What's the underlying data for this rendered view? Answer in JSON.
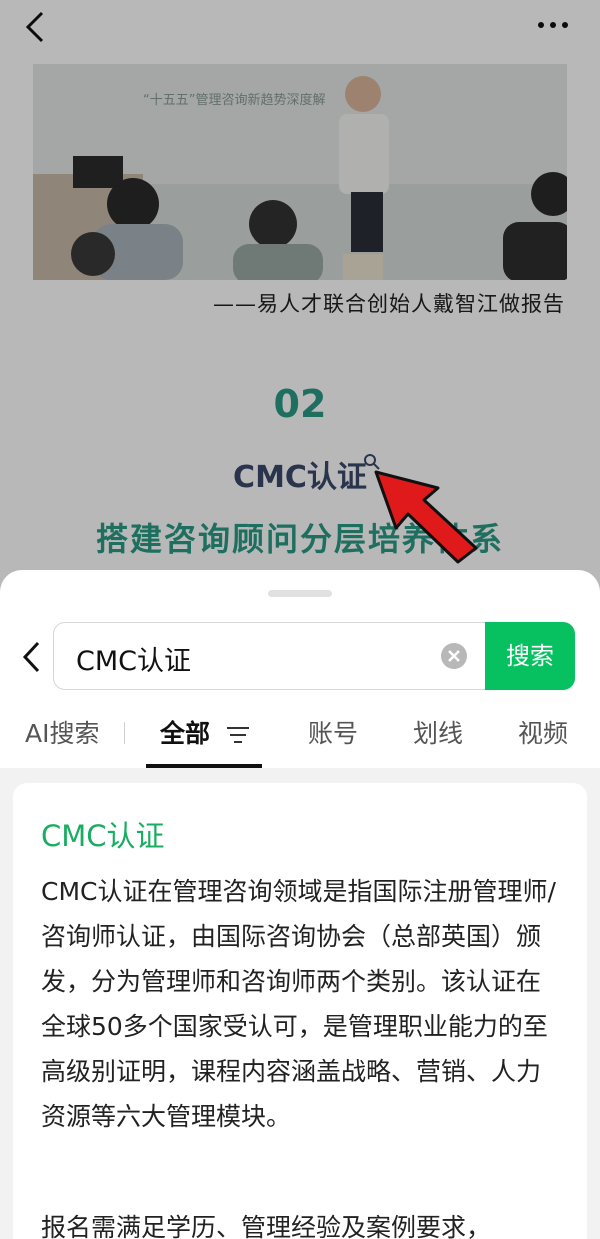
{
  "article": {
    "photo_caption": "——易人才联合创始人戴智江做报告",
    "photo_slide_text": "“十五五”管理咨询新趋势深度解",
    "section_number": "02",
    "section_title": "CMC认证",
    "section_subtitle": "搭建咨询顾问分层培养体系"
  },
  "search": {
    "query": "CMC认证",
    "button_label": "搜索"
  },
  "tabs": [
    {
      "label": "AI搜索"
    },
    {
      "label": "全部"
    },
    {
      "label": "账号"
    },
    {
      "label": "划线"
    },
    {
      "label": "视频"
    }
  ],
  "result": {
    "title": "CMC认证",
    "paragraph1": "CMC认证在管理咨询领域是指国际注册管理师/咨询师认证，由国际咨询协会（总部英国）颁发，分为管理师和咨询师两个类别。该认证在全球50多个国家受认可，是管理职业能力的至高级别证明，课程内容涵盖战略、营销、人力资源等六大管理模块。",
    "paragraph2": "报名需满足学历、管理经验及案例要求，"
  },
  "colors": {
    "accent_green": "#07c160",
    "teal": "#2a9a84",
    "navy": "#3b4a6b",
    "red_arrow": "#e01a1a"
  }
}
